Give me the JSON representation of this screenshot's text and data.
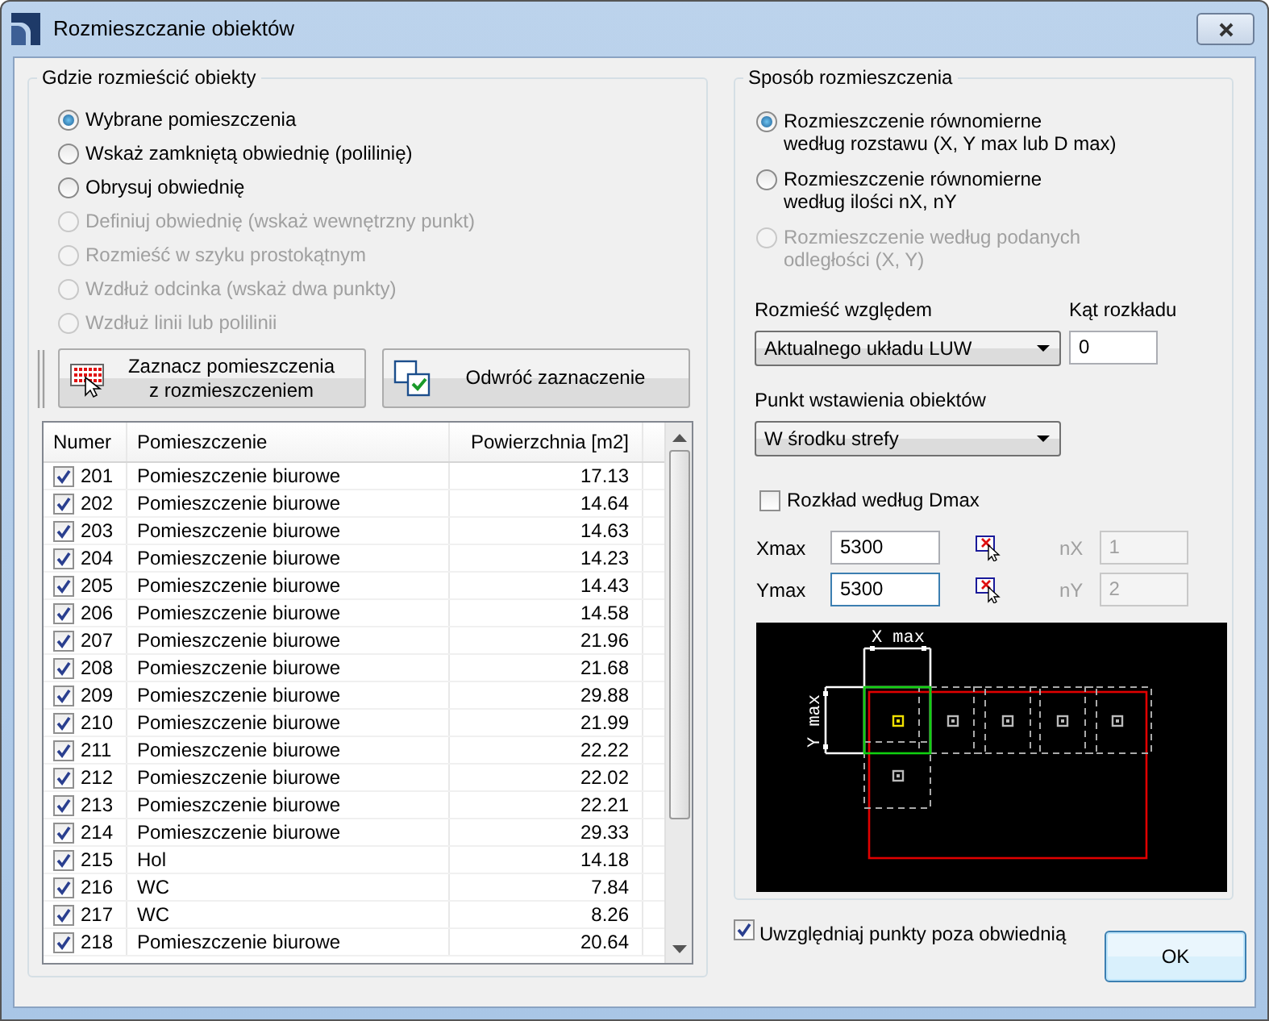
{
  "window": {
    "title": "Rozmieszczanie obiektów"
  },
  "placement": {
    "title": "Gdzie rozmieścić obiekty",
    "options": [
      {
        "label": "Wybrane pomieszczenia",
        "selected": true,
        "disabled": false
      },
      {
        "label": "Wskaż zamkniętą obwiednię (polilinię)",
        "selected": false,
        "disabled": false
      },
      {
        "label": "Obrysuj obwiednię",
        "selected": false,
        "disabled": false
      },
      {
        "label": "Definiuj obwiednię (wskaż wewnętrzny punkt)",
        "selected": false,
        "disabled": true
      },
      {
        "label": "Rozmieść w szyku prostokątnym",
        "selected": false,
        "disabled": true
      },
      {
        "label": "Wzdłuż odcinka (wskaż dwa punkty)",
        "selected": false,
        "disabled": true
      },
      {
        "label": "Wzdłuż linii lub polilinii",
        "selected": false,
        "disabled": true
      }
    ],
    "buttons": [
      {
        "kind": "mark",
        "label": "Zaznacz pomieszczenia\nz rozmieszczeniem"
      },
      {
        "kind": "invert",
        "label": "Odwróć zaznaczenie"
      }
    ]
  },
  "rooms_table": {
    "columns": [
      "Numer",
      "Pomieszczenie",
      "Powierzchnia [m2]"
    ],
    "rows": [
      {
        "checked": true,
        "number": "201",
        "name": "Pomieszczenie biurowe",
        "area": "17.13"
      },
      {
        "checked": true,
        "number": "202",
        "name": "Pomieszczenie biurowe",
        "area": "14.64"
      },
      {
        "checked": true,
        "number": "203",
        "name": "Pomieszczenie biurowe",
        "area": "14.63"
      },
      {
        "checked": true,
        "number": "204",
        "name": "Pomieszczenie biurowe",
        "area": "14.23"
      },
      {
        "checked": true,
        "number": "205",
        "name": "Pomieszczenie biurowe",
        "area": "14.43"
      },
      {
        "checked": true,
        "number": "206",
        "name": "Pomieszczenie biurowe",
        "area": "14.58"
      },
      {
        "checked": true,
        "number": "207",
        "name": "Pomieszczenie biurowe",
        "area": "21.96"
      },
      {
        "checked": true,
        "number": "208",
        "name": "Pomieszczenie biurowe",
        "area": "21.68"
      },
      {
        "checked": true,
        "number": "209",
        "name": "Pomieszczenie biurowe",
        "area": "29.88"
      },
      {
        "checked": true,
        "number": "210",
        "name": "Pomieszczenie biurowe",
        "area": "21.99"
      },
      {
        "checked": true,
        "number": "211",
        "name": "Pomieszczenie biurowe",
        "area": "22.22"
      },
      {
        "checked": true,
        "number": "212",
        "name": "Pomieszczenie biurowe",
        "area": "22.02"
      },
      {
        "checked": true,
        "number": "213",
        "name": "Pomieszczenie biurowe",
        "area": "22.21"
      },
      {
        "checked": true,
        "number": "214",
        "name": "Pomieszczenie biurowe",
        "area": "29.33"
      },
      {
        "checked": true,
        "number": "215",
        "name": "Hol",
        "area": "14.18"
      },
      {
        "checked": true,
        "number": "216",
        "name": "WC",
        "area": "7.84"
      },
      {
        "checked": true,
        "number": "217",
        "name": "WC",
        "area": "8.26"
      },
      {
        "checked": true,
        "number": "218",
        "name": "Pomieszczenie biurowe",
        "area": "20.64"
      }
    ]
  },
  "distribution": {
    "title": "Sposób rozmieszczenia",
    "options": [
      {
        "label": "Rozmieszczenie równomierne\nwedług rozstawu (X, Y max lub D max)",
        "selected": true,
        "disabled": false
      },
      {
        "label": "Rozmieszczenie równomierne\nwedług ilości nX, nY",
        "selected": false,
        "disabled": false
      },
      {
        "label": "Rozmieszczenie według podanych\nodległości (X, Y)",
        "selected": false,
        "disabled": true
      }
    ],
    "relative_to": {
      "label": "Rozmieść względem",
      "value": "Aktualnego układu LUW"
    },
    "angle": {
      "label": "Kąt rozkładu",
      "value": "0"
    },
    "insertion_point": {
      "label": "Punkt wstawienia obiektów",
      "value": "W środku strefy"
    },
    "dmax": {
      "label": "Rozkład według Dmax",
      "checked": false
    },
    "spacing": [
      {
        "label": "Xmax",
        "value": "5300",
        "focused": false,
        "count_label": "nX",
        "count_value": "1",
        "count_disabled": true
      },
      {
        "label": "Ymax",
        "value": "5300",
        "focused": true,
        "count_label": "nY",
        "count_value": "2",
        "count_disabled": true
      }
    ],
    "diagram": {
      "x_label": "X max",
      "y_label": "Y max"
    }
  },
  "outside_points": {
    "label": "Uwzględniaj punkty poza obwiednią",
    "checked": true
  },
  "ok_button": {
    "label": "OK"
  }
}
